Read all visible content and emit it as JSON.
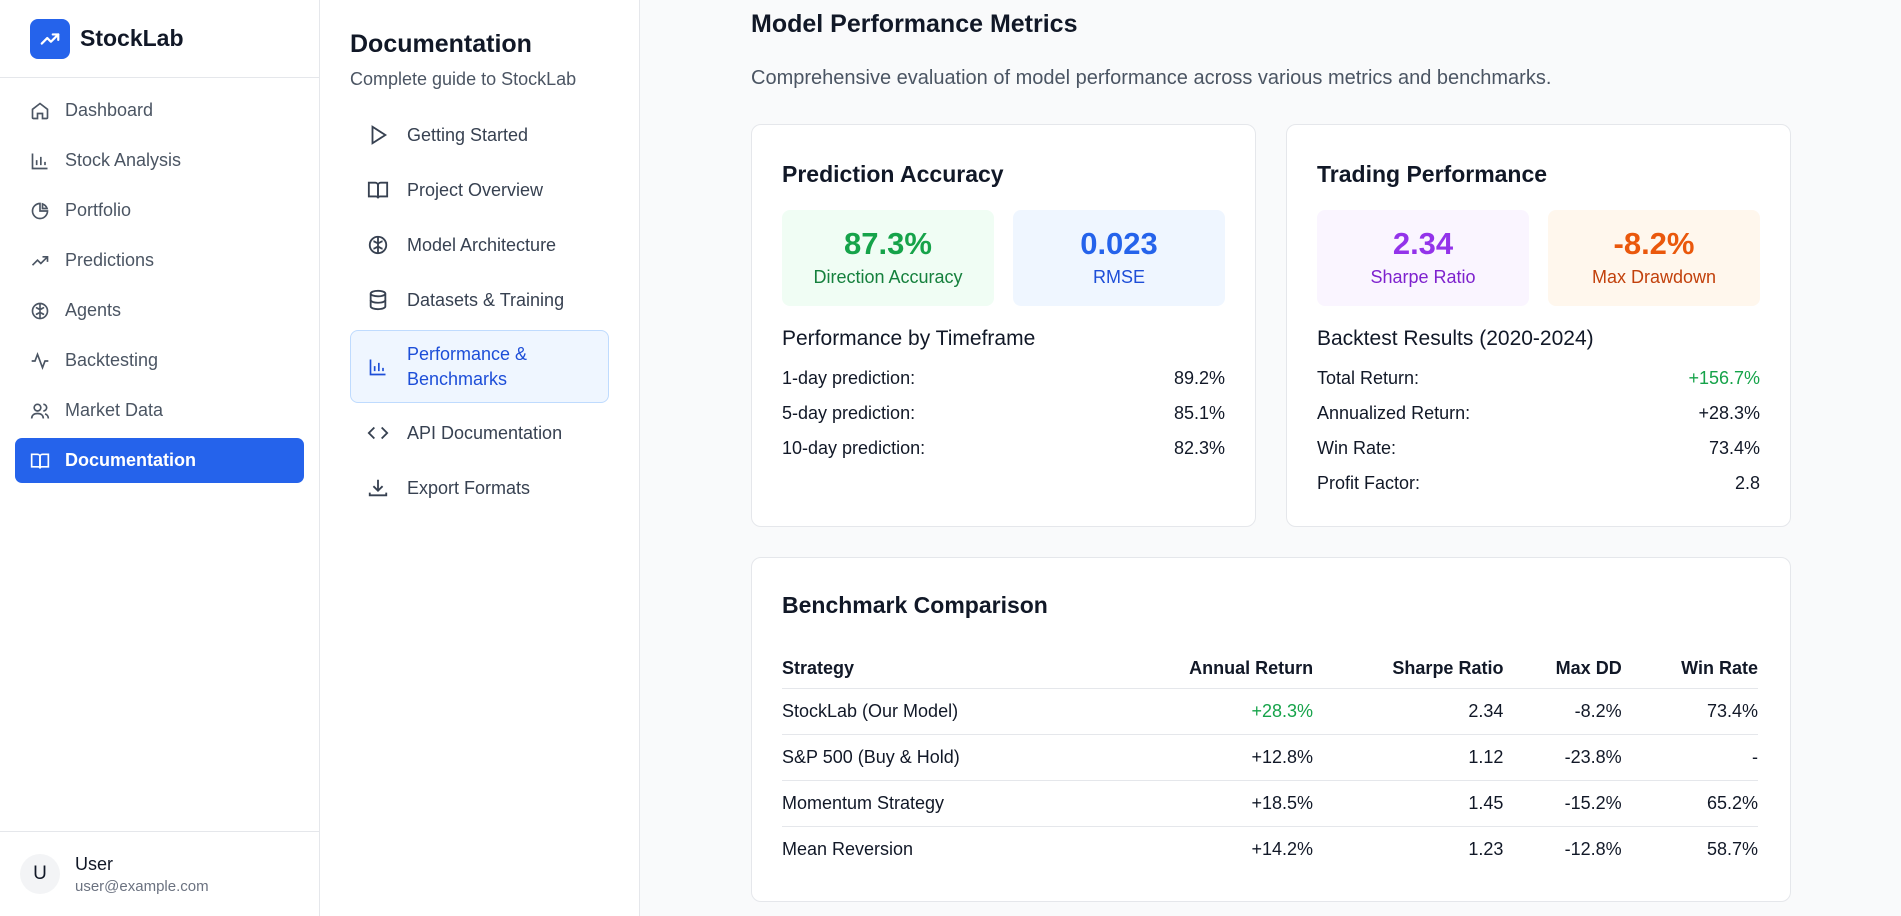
{
  "brand": {
    "name": "StockLab"
  },
  "sidebar": {
    "items": [
      {
        "label": "Dashboard",
        "icon": "home-icon"
      },
      {
        "label": "Stock Analysis",
        "icon": "bar-chart-icon"
      },
      {
        "label": "Portfolio",
        "icon": "pie-chart-icon"
      },
      {
        "label": "Predictions",
        "icon": "trending-up-icon"
      },
      {
        "label": "Agents",
        "icon": "brain-icon"
      },
      {
        "label": "Backtesting",
        "icon": "activity-icon"
      },
      {
        "label": "Market Data",
        "icon": "users-icon"
      },
      {
        "label": "Documentation",
        "icon": "book-icon",
        "active": true
      }
    ]
  },
  "user": {
    "initial": "U",
    "name": "User",
    "email": "user@example.com"
  },
  "docnav": {
    "title": "Documentation",
    "subtitle": "Complete guide to StockLab",
    "items": [
      {
        "label": "Getting Started",
        "icon": "play-icon"
      },
      {
        "label": "Project Overview",
        "icon": "book-open-icon"
      },
      {
        "label": "Model Architecture",
        "icon": "brain-icon"
      },
      {
        "label": "Datasets & Training",
        "icon": "database-icon"
      },
      {
        "label": "Performance & Benchmarks",
        "icon": "bar-chart-icon",
        "active": true
      },
      {
        "label": "API Documentation",
        "icon": "code-icon"
      },
      {
        "label": "Export Formats",
        "icon": "download-icon"
      }
    ]
  },
  "main": {
    "title": "Model Performance Metrics",
    "description": "Comprehensive evaluation of model performance across various metrics and benchmarks."
  },
  "accuracy": {
    "title": "Prediction Accuracy",
    "stats": [
      {
        "value": "87.3%",
        "label": "Direction Accuracy"
      },
      {
        "value": "0.023",
        "label": "RMSE"
      }
    ],
    "timeframe_title": "Performance by Timeframe",
    "timeframes": [
      {
        "label": "1-day prediction:",
        "value": "89.2%"
      },
      {
        "label": "5-day prediction:",
        "value": "85.1%"
      },
      {
        "label": "10-day prediction:",
        "value": "82.3%"
      }
    ]
  },
  "trading": {
    "title": "Trading Performance",
    "stats": [
      {
        "value": "2.34",
        "label": "Sharpe Ratio"
      },
      {
        "value": "-8.2%",
        "label": "Max Drawdown"
      }
    ],
    "backtest_title": "Backtest Results (2020-2024)",
    "results": [
      {
        "label": "Total Return:",
        "value": "+156.7%"
      },
      {
        "label": "Annualized Return:",
        "value": "+28.3%"
      },
      {
        "label": "Win Rate:",
        "value": "73.4%"
      },
      {
        "label": "Profit Factor:",
        "value": "2.8"
      }
    ]
  },
  "benchmark": {
    "title": "Benchmark Comparison",
    "columns": [
      "Strategy",
      "Annual Return",
      "Sharpe Ratio",
      "Max DD",
      "Win Rate"
    ],
    "rows": [
      [
        "StockLab (Our Model)",
        "+28.3%",
        "2.34",
        "-8.2%",
        "73.4%"
      ],
      [
        "S&P 500 (Buy & Hold)",
        "+12.8%",
        "1.12",
        "-23.8%",
        "-"
      ],
      [
        "Momentum Strategy",
        "+18.5%",
        "1.45",
        "-15.2%",
        "65.2%"
      ],
      [
        "Mean Reversion",
        "+14.2%",
        "1.23",
        "-12.8%",
        "58.7%"
      ]
    ]
  },
  "colors": {
    "accent": "#2563eb",
    "positive": "#16a34a",
    "sharpe": "#9333ea",
    "drawdown": "#ea580c"
  }
}
